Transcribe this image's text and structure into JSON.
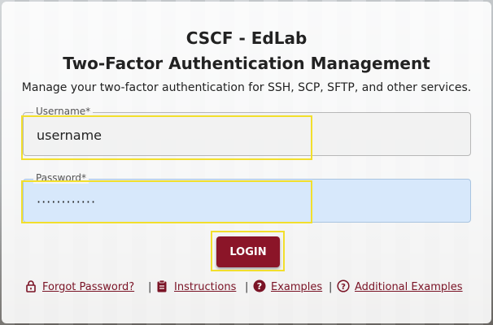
{
  "header": {
    "title": "CSCF - EdLab",
    "subtitle": "Two-Factor Authentication Management",
    "description": "Manage your two-factor authentication for SSH, SCP, SFTP, and other services."
  },
  "form": {
    "username_label": "Username*",
    "username_value": "username",
    "password_label": "Password*",
    "password_value": "············",
    "login_label": "LOGIN"
  },
  "links": {
    "forgot_password": "Forgot Password?",
    "instructions": "Instructions",
    "examples": "Examples",
    "additional_examples": "Additional Examples",
    "separator": "|"
  },
  "colors": {
    "accent": "#8b1528",
    "link": "#7a1325",
    "highlight": "#f2df2c"
  }
}
